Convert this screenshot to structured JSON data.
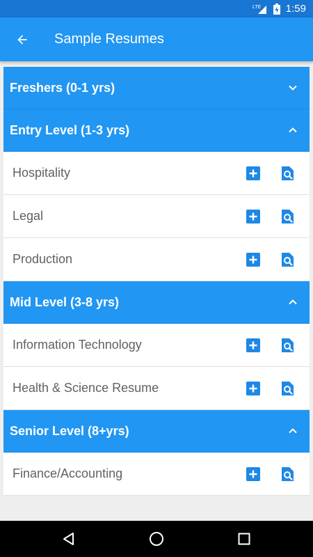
{
  "status_bar": {
    "network": "LTE",
    "time": "1:59"
  },
  "app_bar": {
    "title": "Sample Resumes",
    "back_icon": "arrow-back-icon"
  },
  "colors": {
    "primary": "#2196f3",
    "primary_dark": "#1976d2",
    "background": "#eeeeee",
    "row_text": "#616161"
  },
  "sections": [
    {
      "label": "Freshers (0-1 yrs)",
      "expanded": false,
      "items": []
    },
    {
      "label": "Entry Level (1-3 yrs)",
      "expanded": true,
      "items": [
        "Hospitality",
        "Legal",
        "Production"
      ]
    },
    {
      "label": "Mid Level (3-8 yrs)",
      "expanded": true,
      "items": [
        "Information Technology",
        "Health & Science Resume"
      ]
    },
    {
      "label": "Senior Level (8+yrs)",
      "expanded": true,
      "items": [
        "Finance/Accounting"
      ]
    }
  ],
  "row_actions": {
    "add_icon": "add-box-icon",
    "view_icon": "search-document-icon"
  },
  "nav_bar": {
    "back_icon": "nav-back-icon",
    "home_icon": "nav-home-icon",
    "recents_icon": "nav-recents-icon"
  }
}
